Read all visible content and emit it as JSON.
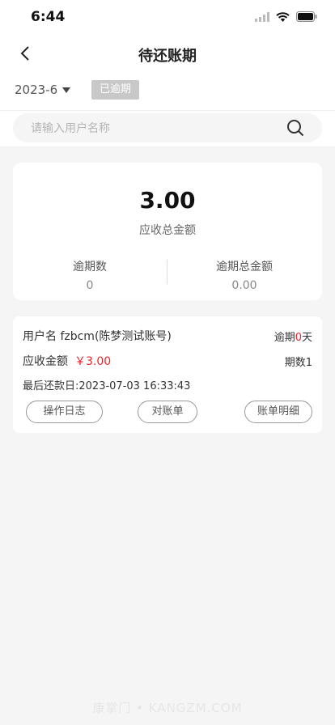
{
  "status": {
    "time": "6:44"
  },
  "nav": {
    "title": "待还账期"
  },
  "filter": {
    "month": "2023-6",
    "overdue_tag": "已逾期"
  },
  "search": {
    "placeholder": "请输入用户名称"
  },
  "summary": {
    "total_amount": "3.00",
    "total_label": "应收总金额",
    "overdue_count_label": "逾期数",
    "overdue_count_value": "0",
    "overdue_total_label": "逾期总金额",
    "overdue_total_value": "0.00"
  },
  "bill": {
    "user_name": "用户名 fzbcm(陈梦测试账号)",
    "overdue_prefix": "逾期",
    "overdue_days": "0",
    "overdue_suffix": "天",
    "receivable_label": "应收金额",
    "receivable_amount": "￥3.00",
    "periods": "期数1",
    "last_payment": "最后还款日:2023-07-03 16:33:43",
    "btn_log": "操作日志",
    "btn_check": "对账单",
    "btn_detail": "账单明细"
  },
  "watermark": "康掌门 • KANGZM.COM",
  "colors": {
    "accent_red": "#e8262c",
    "tag_gray": "#c8c8c8"
  }
}
